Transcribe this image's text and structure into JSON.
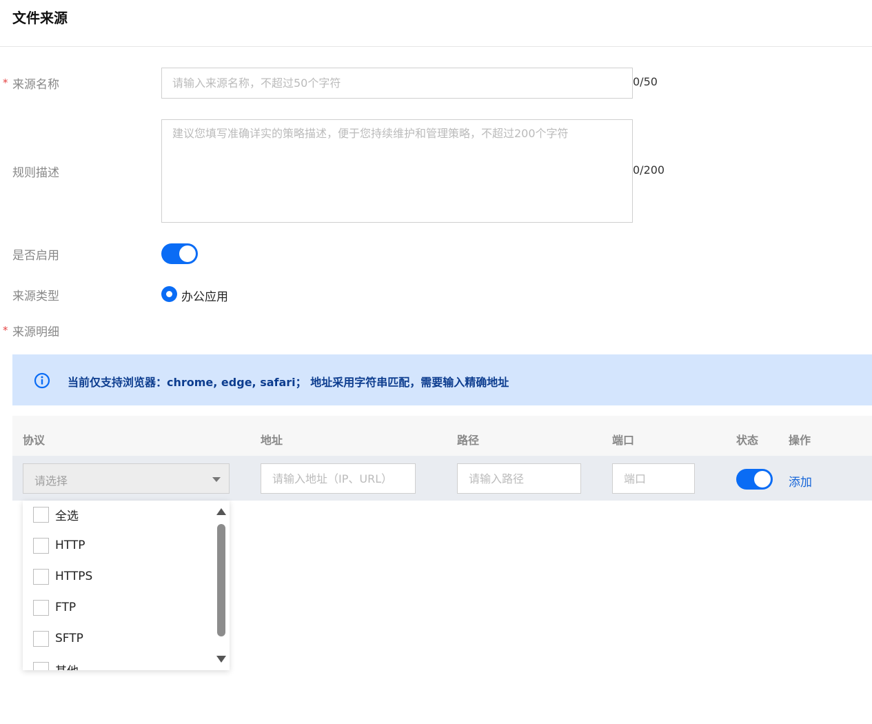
{
  "page": {
    "title": "文件来源"
  },
  "form": {
    "name": {
      "label": "来源名称",
      "required_mark": "*",
      "placeholder": "请输入来源名称，不超过50个字符",
      "value": "",
      "counter": "0/50"
    },
    "description": {
      "label": "规则描述",
      "placeholder": "建议您填写准确详实的策略描述，便于您持续维护和管理策略，不超过200个字符",
      "value": "",
      "counter": "0/200"
    },
    "enabled": {
      "label": "是否启用",
      "checked": true
    },
    "source_type": {
      "label": "来源类型",
      "option": "办公应用",
      "selected": true
    },
    "detail": {
      "label": "来源明细",
      "required_mark": "*"
    }
  },
  "notice": {
    "icon": "info-icon",
    "text": "当前仅支持浏览器：chrome, edge, safari； 地址采用字符串匹配，需要输入精确地址"
  },
  "table": {
    "headers": {
      "protocol": "协议",
      "address": "地址",
      "path": "路径",
      "port": "端口",
      "status": "状态",
      "action": "操作"
    },
    "row": {
      "protocol_placeholder": "请选择",
      "address_placeholder": "请输入地址（IP、URL）",
      "path_placeholder": "请输入路径",
      "port_placeholder": "端口",
      "status_on": true,
      "action_label": "添加"
    }
  },
  "dropdown": {
    "options": [
      {
        "label": "全选",
        "checked": false
      },
      {
        "label": "HTTP",
        "checked": false
      },
      {
        "label": "HTTPS",
        "checked": false
      },
      {
        "label": "FTP",
        "checked": false
      },
      {
        "label": "SFTP",
        "checked": false
      },
      {
        "label": "其他",
        "checked": false
      }
    ]
  },
  "colors": {
    "accent": "#0a6cf5",
    "notice_bg": "#d4e5fd",
    "notice_text": "#0d3d8f",
    "link": "#1665d8",
    "required": "#e54545"
  }
}
